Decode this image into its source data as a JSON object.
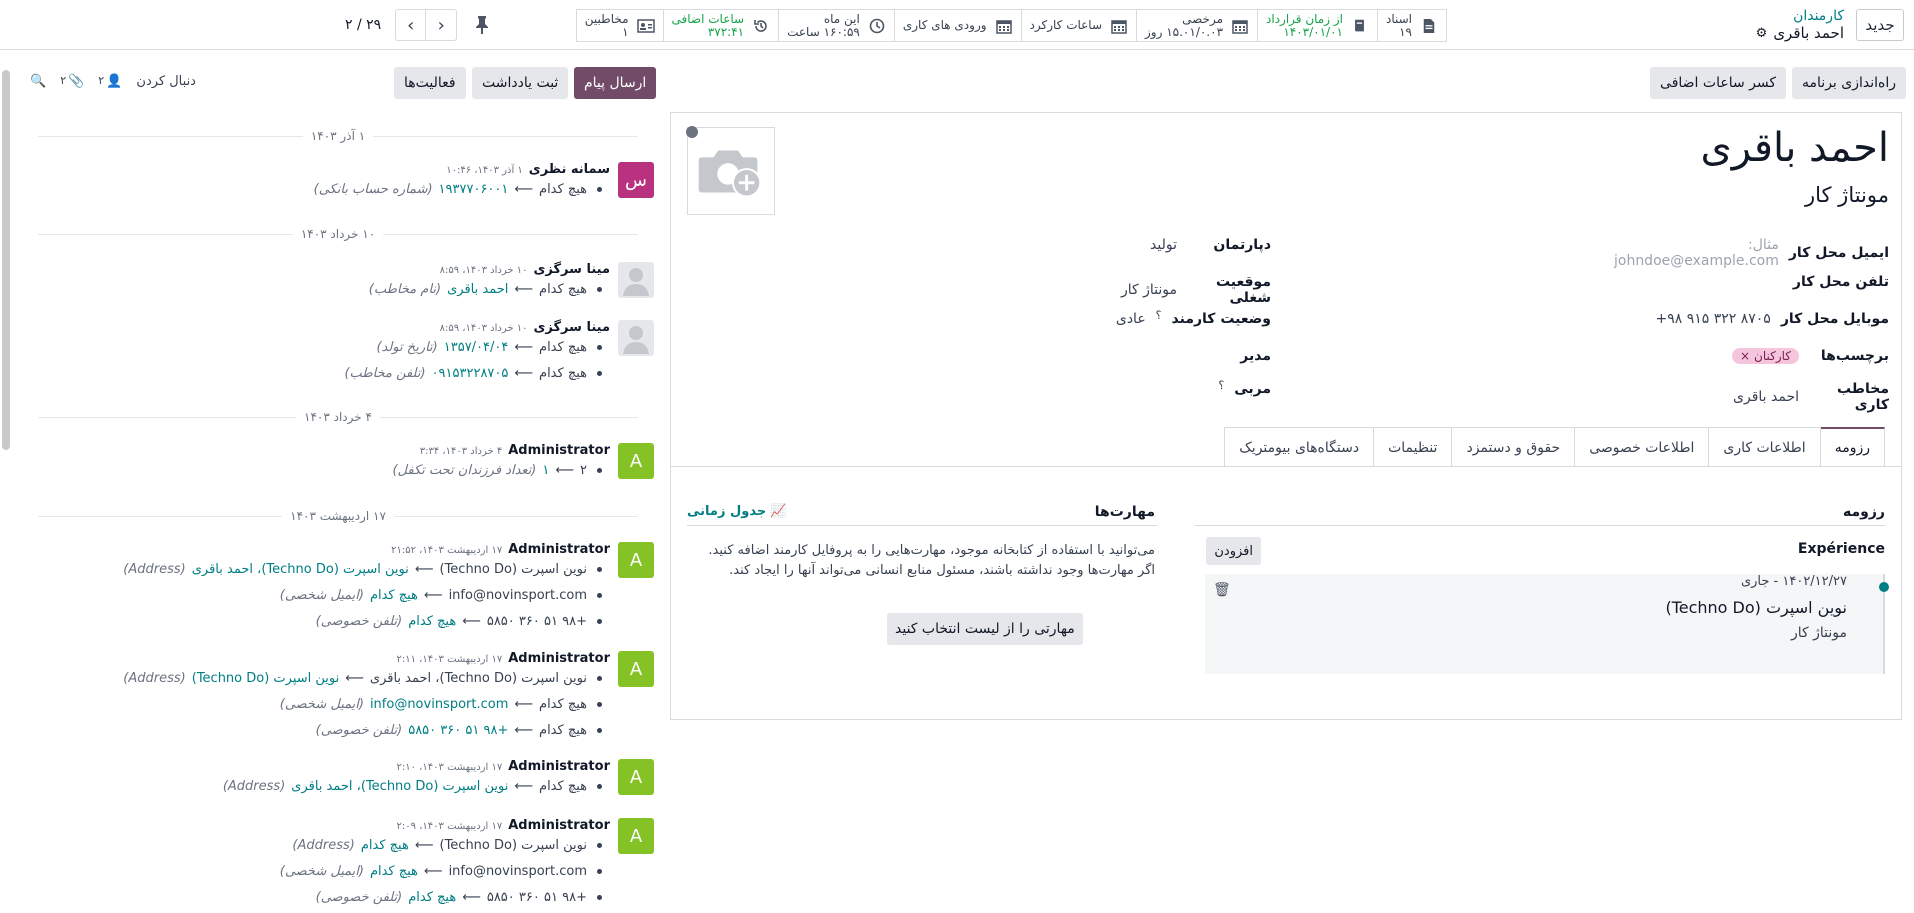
{
  "topbar": {
    "new_button": "جدید",
    "breadcrumb_parent": "کارمندان",
    "breadcrumb_current": "احمد باقری",
    "stats": [
      {
        "label": "اسناد",
        "value": "۱۹",
        "icon": "document-icon",
        "green": false
      },
      {
        "label": "از زمان قرارداد",
        "value": "۱۴۰۳/۰۱/۰۱",
        "icon": "book-icon",
        "green": true
      },
      {
        "label": "مرخصی",
        "value": "۱۵.۰۱/۰.۰۳ روز",
        "icon": "calendar-icon",
        "green": false
      },
      {
        "label": "ساعات کارکرد",
        "value": "",
        "icon": "calendar-icon",
        "green": false
      },
      {
        "label": "ورودی های کاری",
        "value": "",
        "icon": "calendar-icon",
        "green": false
      },
      {
        "label": "این ماه",
        "value": "۱۶۰:۵۹ ساعت",
        "icon": "clock-icon",
        "green": false
      },
      {
        "label": "ساعات اضافی",
        "value": "۳۷۲:۴۱",
        "icon": "history-icon",
        "green": true
      },
      {
        "label": "مخاطبین",
        "value": "۱",
        "icon": "address-card-icon",
        "green": false
      }
    ],
    "pager_count": "۲۹ / ۲"
  },
  "actions": {
    "plan": "راه‌اندازی برنامه",
    "deduct": "کسر ساعات اضافی"
  },
  "employee": {
    "name": "احمد باقری",
    "job_title": "مونتاژ کار",
    "fields": {
      "work_email_label": "ایمیل محل کار",
      "work_email_placeholder": "مثال: johndoe@example.com",
      "work_phone_label": "تلفن محل کار",
      "mobile_label": "موبایل محل کار",
      "mobile_value": "+۹۸ ۹۱۵ ۳۲۲ ۸۷۰۵",
      "tags_label": "برچسب‌ها",
      "tag_value": "کارکنان",
      "contact_label": "مخاطب کاری",
      "contact_value": "احمد باقری",
      "department_label": "دپارتمان",
      "department_value": "تولید",
      "position_label": "موقعیت شغلی",
      "position_value": "مونتاژ کار",
      "status_label": "وضعیت کارمند",
      "status_value": "عادی",
      "manager_label": "مدیر",
      "coach_label": "مربی"
    },
    "tabs": [
      "رزومه",
      "اطلاعات کاری",
      "اطلاعات خصوصی",
      "حقوق و دستمزد",
      "تنظیمات",
      "دستگاه‌های بیومتریک"
    ],
    "resume": {
      "section": "رزومه",
      "experience": "Expérience",
      "add": "افزودن",
      "date_range": "۱۴۰۲/۱۲/۲۷ - جاری",
      "company": "نوین اسپرت (Techno Do)",
      "role": "مونتاژ کار"
    },
    "skills": {
      "section": "مهارت‌ها",
      "timeline": "جدول زمانی",
      "hint1": "می‌توانید با استفاده از کتابخانه موجود، مهارت‌هایی را به پروفایل کارمند اضافه کنید.",
      "hint2": "اگر مهارت‌ها وجود نداشته باشند، مسئول منابع انسانی می‌تواند آنها را ایجاد کند.",
      "pick_button": "مهارتی را از لیست انتخاب کنید"
    }
  },
  "chatter": {
    "send_message": "ارسال پیام",
    "log_note": "ثبت یادداشت",
    "activities": "فعالیت‌ها",
    "follow": "دنبال کردن",
    "followers_count": "۲",
    "attachments_count": "۲",
    "dates": [
      "۱ آذر ۱۴۰۳",
      "۱۰ خرداد ۱۴۰۳",
      "۴ خرداد ۱۴۰۳",
      "۱۷ اردیبهشت ۱۴۰۳"
    ],
    "none": "هیچ کدام",
    "messages": [
      {
        "author": "سمانه نظری",
        "date": "۱ آذر ۱۴۰۳، ۱۰:۴۶",
        "avatar": "س",
        "color": "#b83280",
        "lines": [
          {
            "old": "هیچ کدام",
            "new": "۱۹۳۷۷۰۶۰۰۱",
            "field": "(شماره حساب بانکی)"
          }
        ]
      },
      {
        "author": "مینا سرگزی",
        "date": "۱۰ خرداد ۱۴۰۳، ۸:۵۹",
        "avatar": "",
        "color": "#e5e7eb",
        "lines": [
          {
            "old": "هیچ کدام",
            "new": "احمد باقری",
            "field": "(نام مخاطب)"
          }
        ]
      },
      {
        "author": "مینا سرگزی",
        "date": "۱۰ خرداد ۱۴۰۳، ۸:۵۹",
        "avatar": "",
        "color": "#e5e7eb",
        "lines": [
          {
            "old": "هیچ کدام",
            "new": "۱۳۵۷/۰۴/۰۴",
            "field": "(تاریخ تولد)"
          },
          {
            "old": "هیچ کدام",
            "new": "۰۹۱۵۳۲۲۸۷۰۵",
            "field": "(تلفن مخاطب)"
          }
        ]
      },
      {
        "author": "Administrator",
        "date": "۴ خرداد ۱۴۰۳، ۳:۳۴",
        "avatar": "A",
        "color": "#84c225",
        "lines": [
          {
            "old": "۲",
            "new": "۱",
            "field": "(تعداد فرزندان تحت تکفل)"
          }
        ]
      },
      {
        "author": "Administrator",
        "date": "۱۷ اردیبهشت ۱۴۰۳، ۲۱:۵۲",
        "avatar": "A",
        "color": "#84c225",
        "lines": [
          {
            "old": "نوین اسپرت (Techno Do)",
            "new": "نوین اسپرت (Techno Do)، احمد باقری",
            "field": "(Address)"
          },
          {
            "old": "info@novinsport.com",
            "new": "هیچ کدام",
            "field": "(ایمیل شخصی)"
          },
          {
            "old": "+۹۸ ۵۱ ۳۶۰ ۵۸۵۰",
            "new": "هیچ کدام",
            "field": "(تلفن خصوصی)"
          }
        ]
      },
      {
        "author": "Administrator",
        "date": "۱۷ اردیبهشت ۱۴۰۳، ۲:۱۱",
        "avatar": "A",
        "color": "#84c225",
        "lines": [
          {
            "old": "نوین اسپرت (Techno Do)، احمد باقری",
            "new": "نوین اسپرت (Techno Do)",
            "field": "(Address)"
          },
          {
            "old": "هیچ کدام",
            "new": "info@novinsport.com",
            "field": "(ایمیل شخصی)"
          },
          {
            "old": "هیچ کدام",
            "new": "+۹۸ ۵۱ ۳۶۰ ۵۸۵۰",
            "field": "(تلفن خصوصی)"
          }
        ]
      },
      {
        "author": "Administrator",
        "date": "۱۷ اردیبهشت ۱۴۰۳، ۲:۱۰",
        "avatar": "A",
        "color": "#84c225",
        "lines": [
          {
            "old": "هیچ کدام",
            "new": "نوین اسپرت (Techno Do)، احمد باقری",
            "field": "(Address)"
          }
        ]
      },
      {
        "author": "Administrator",
        "date": "۱۷ اردیبهشت ۱۴۰۳، ۲:۰۹",
        "avatar": "A",
        "color": "#84c225",
        "lines": [
          {
            "old": "نوین اسپرت (Techno Do)",
            "new": "هیچ کدام",
            "field": "(Address)"
          },
          {
            "old": "info@novinsport.com",
            "new": "هیچ کدام",
            "field": "(ایمیل شخصی)"
          },
          {
            "old": "+۹۸ ۵۱ ۳۶۰ ۵۸۵۰",
            "new": "هیچ کدام",
            "field": "(تلفن خصوصی)"
          }
        ]
      }
    ]
  }
}
